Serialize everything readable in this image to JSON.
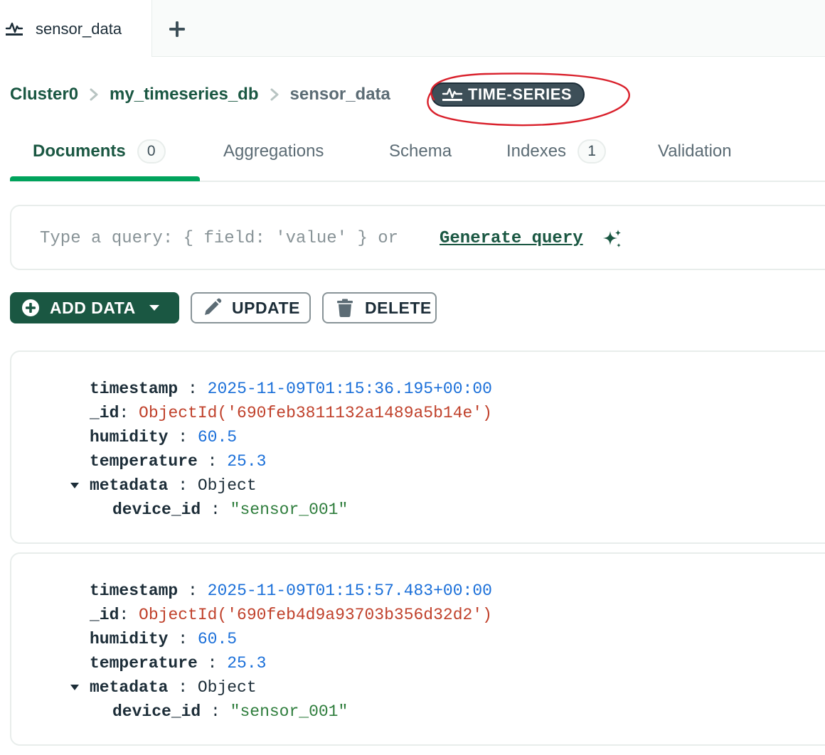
{
  "tab": {
    "label": "sensor_data"
  },
  "breadcrumb": {
    "cluster": "Cluster0",
    "database": "my_timeseries_db",
    "collection": "sensor_data",
    "badge": "TIME-SERIES"
  },
  "content_tabs": [
    {
      "label": "Documents",
      "count": "0",
      "active": true
    },
    {
      "label": "Aggregations"
    },
    {
      "label": "Schema"
    },
    {
      "label": "Indexes",
      "count": "1"
    },
    {
      "label": "Validation"
    }
  ],
  "query": {
    "placeholder": "Type a query: { field: 'value' } or ",
    "generate_label": "Generate query"
  },
  "actions": {
    "add_data": "ADD DATA",
    "update": "UPDATE",
    "delete": "DELETE"
  },
  "documents": [
    {
      "timestamp": "2025-11-09T01:15:36.195+00:00",
      "_id": "ObjectId('690feb3811132a1489a5b14e')",
      "humidity": "60.5",
      "temperature": "25.3",
      "metadata_type": "Object",
      "device_id": "\"sensor_001\""
    },
    {
      "timestamp": "2025-11-09T01:15:57.483+00:00",
      "_id": "ObjectId('690feb4d9a93703b356d32d2')",
      "humidity": "60.5",
      "temperature": "25.3",
      "metadata_type": "Object",
      "device_id": "\"sensor_001\""
    }
  ],
  "field_keys": {
    "timestamp": "timestamp",
    "id": "_id",
    "humidity": "humidity",
    "temperature": "temperature",
    "metadata": "metadata",
    "device_id": "device_id"
  },
  "colors": {
    "brand_green": "#1a5742",
    "active_underline": "#00a35c",
    "badge_bg": "#3d4f58",
    "annotation_red": "#d9202b"
  },
  "icons": {
    "tab": "timeseries-icon",
    "new_tab": "plus-icon",
    "badge": "timeseries-icon",
    "generate": "sparkle-icon",
    "add": "plus-circle-icon",
    "update": "pencil-icon",
    "delete": "trash-icon"
  }
}
